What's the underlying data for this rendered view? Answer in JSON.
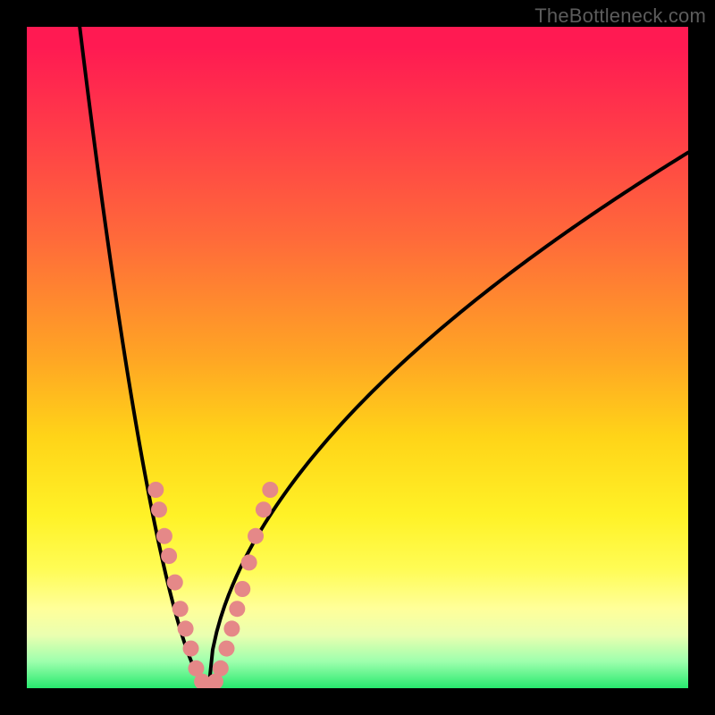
{
  "attribution": "TheBottleneck.com",
  "chart_data": {
    "type": "line",
    "title": "",
    "xlabel": "",
    "ylabel": "",
    "xlim": [
      0,
      100
    ],
    "ylim": [
      0,
      100
    ],
    "notes": "V-shaped bottleneck curve over a red-to-green vertical gradient. x ≈ parameter sweep, y ≈ mismatch score (0 at bottom/green = balanced).",
    "curve": {
      "vertex_x": 27.5,
      "left_start": {
        "x": 8,
        "y": 100
      },
      "right_end": {
        "x": 100,
        "y": 81
      }
    },
    "gradient_stops": [
      {
        "pct": 0,
        "color": "#ff1a52"
      },
      {
        "pct": 50,
        "color": "#ffa524"
      },
      {
        "pct": 82,
        "color": "#fffc55"
      },
      {
        "pct": 100,
        "color": "#27e96e"
      }
    ],
    "dots": {
      "color": "#e58888",
      "radius": 9,
      "points": [
        {
          "x": 19.5,
          "y": 30
        },
        {
          "x": 20.0,
          "y": 27
        },
        {
          "x": 20.8,
          "y": 23
        },
        {
          "x": 21.5,
          "y": 20
        },
        {
          "x": 22.4,
          "y": 16
        },
        {
          "x": 23.2,
          "y": 12
        },
        {
          "x": 24.0,
          "y": 9
        },
        {
          "x": 24.8,
          "y": 6
        },
        {
          "x": 25.6,
          "y": 3
        },
        {
          "x": 26.5,
          "y": 1
        },
        {
          "x": 27.5,
          "y": 0
        },
        {
          "x": 28.5,
          "y": 1
        },
        {
          "x": 29.3,
          "y": 3
        },
        {
          "x": 30.2,
          "y": 6
        },
        {
          "x": 31.0,
          "y": 9
        },
        {
          "x": 31.8,
          "y": 12
        },
        {
          "x": 32.6,
          "y": 15
        },
        {
          "x": 33.6,
          "y": 19
        },
        {
          "x": 34.6,
          "y": 23
        },
        {
          "x": 35.8,
          "y": 27
        },
        {
          "x": 36.8,
          "y": 30
        }
      ]
    }
  }
}
